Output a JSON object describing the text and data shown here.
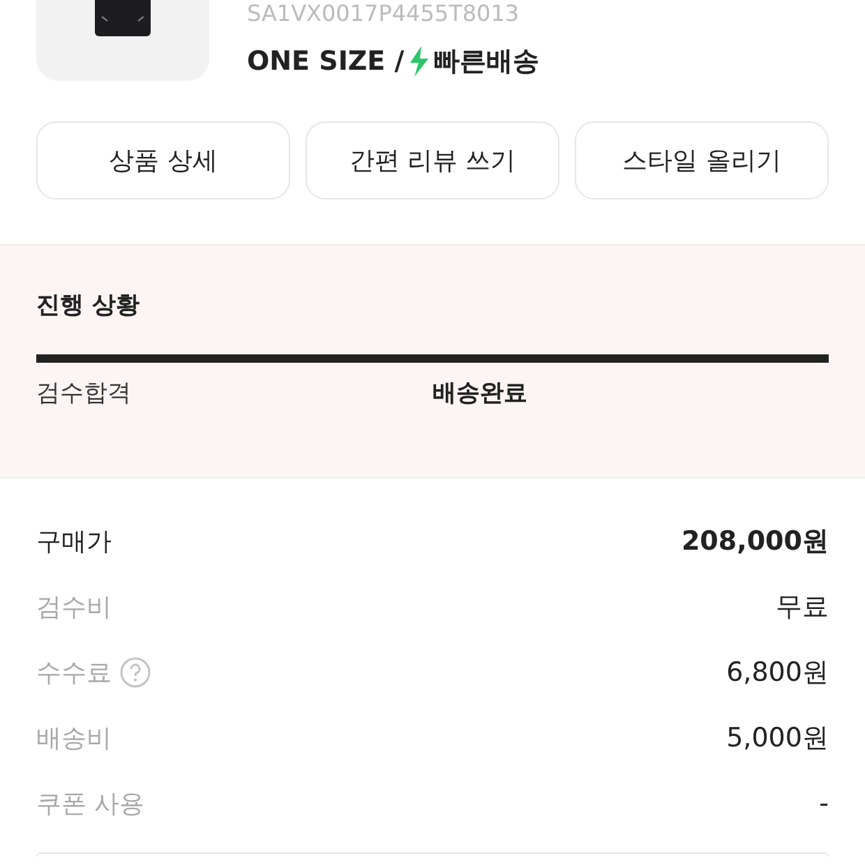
{
  "product": {
    "sku": "SA1VX0017P4455T8013",
    "size": "ONE SIZE /",
    "delivery": "빠른배송"
  },
  "actions": [
    "상품 상세",
    "간편 리뷰 쓰기",
    "스타일 올리기"
  ],
  "progress": {
    "title": "진행 상황",
    "level": 1,
    "steps": [
      {
        "label": "검수합격",
        "selected": false
      },
      {
        "label": "배송완료",
        "selected": true
      }
    ]
  },
  "prices": [
    {
      "label": "구매가",
      "value": "208,000원",
      "emphasis": true,
      "help": false
    },
    {
      "label": "검수비",
      "value": "무료",
      "emphasis": false,
      "help": false
    },
    {
      "label": "수수료",
      "value": "6,800원",
      "emphasis": false,
      "help": true
    },
    {
      "label": "배송비",
      "value": "5,000원",
      "emphasis": false,
      "help": false
    },
    {
      "label": "쿠폰 사용",
      "value": "-",
      "emphasis": false,
      "help": false
    }
  ]
}
